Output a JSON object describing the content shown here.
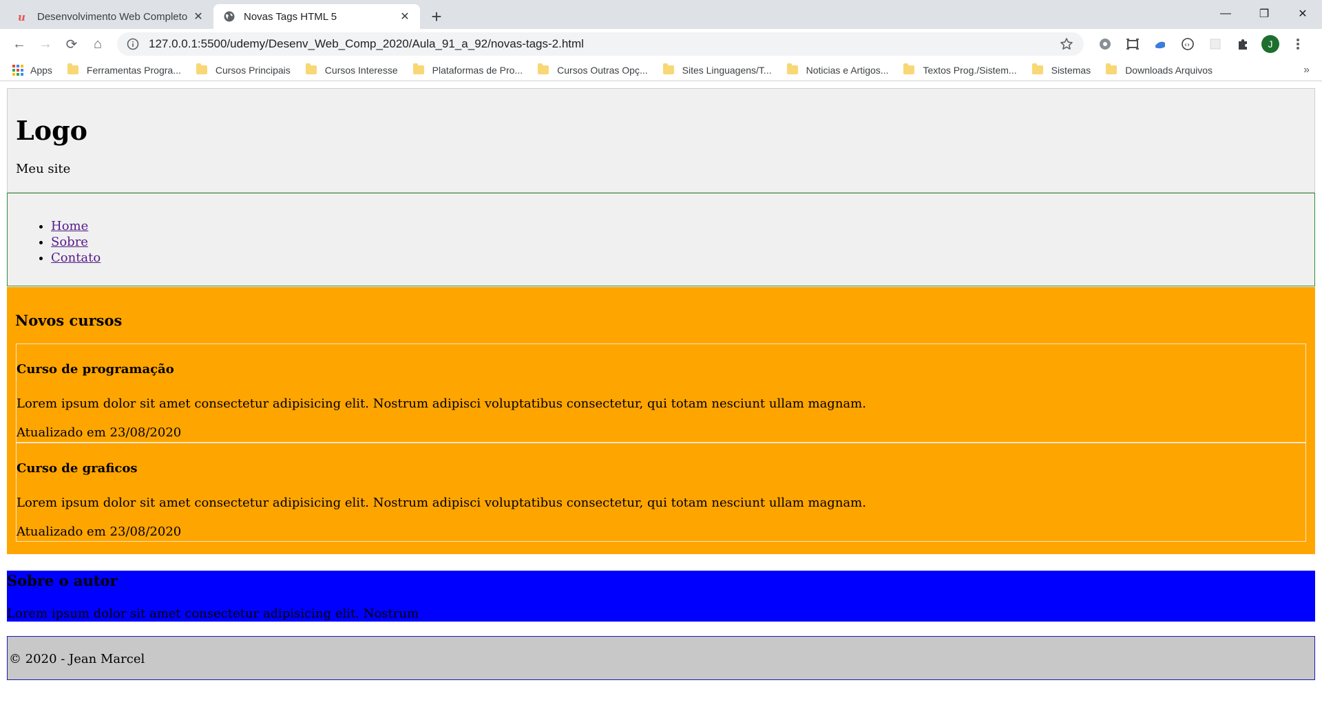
{
  "browser": {
    "tabs": [
      {
        "title": "Desenvolvimento Web Completo",
        "active": false,
        "favicon": "udemy-icon"
      },
      {
        "title": "Novas Tags HTML 5",
        "active": true,
        "favicon": "globe-icon"
      }
    ],
    "new_tab": "+",
    "window_controls": {
      "minimize": "—",
      "restore": "❐",
      "close": "✕"
    },
    "nav": {
      "back": "←",
      "forward": "→",
      "reload": "⟳",
      "home": "⌂"
    },
    "url": "127.0.0.1:5500/udemy/Desenv_Web_Comp_2020/Aula_91_a_92/novas-tags-2.html",
    "profile_initial": "J",
    "bookmarks": [
      {
        "label": "Apps",
        "type": "apps"
      },
      {
        "label": "Ferramentas Progra...",
        "type": "folder"
      },
      {
        "label": "Cursos Principais",
        "type": "folder"
      },
      {
        "label": "Cursos Interesse",
        "type": "folder"
      },
      {
        "label": "Plataformas de Pro...",
        "type": "folder"
      },
      {
        "label": "Cursos Outras Opç...",
        "type": "folder"
      },
      {
        "label": "Sites Linguagens/T...",
        "type": "folder"
      },
      {
        "label": "Noticias e Artigos...",
        "type": "folder"
      },
      {
        "label": "Textos Prog./Sistem...",
        "type": "folder"
      },
      {
        "label": "Sistemas",
        "type": "folder"
      },
      {
        "label": "Downloads Arquivos",
        "type": "folder"
      }
    ],
    "bookmarks_overflow": "»"
  },
  "page": {
    "header": {
      "logo": "Logo",
      "tagline": "Meu site"
    },
    "nav": {
      "items": [
        "Home",
        "Sobre",
        "Contato"
      ]
    },
    "courses": {
      "title": "Novos cursos",
      "items": [
        {
          "title": "Curso de programação",
          "description": "Lorem ipsum dolor sit amet consectetur adipisicing elit. Nostrum adipisci voluptatibus consectetur, qui totam nesciunt ullam magnam.",
          "updated": "Atualizado em 23/08/2020"
        },
        {
          "title": "Curso de graficos",
          "description": "Lorem ipsum dolor sit amet consectetur adipisicing elit. Nostrum adipisci voluptatibus consectetur, qui totam nesciunt ullam magnam.",
          "updated": "Atualizado em 23/08/2020"
        }
      ]
    },
    "author": {
      "title": "Sobre o autor",
      "text": "Lorem ipsum dolor sit amet consectetur adipisicing elit. Nostrum"
    },
    "footer": {
      "text": "© 2020 - Jean Marcel"
    }
  },
  "colors": {
    "header_bg": "#f0f0f0",
    "nav_border": "#2e8b3a",
    "courses_bg": "#ffa500",
    "author_bg": "#0000ff",
    "footer_bg": "#c8c8c8",
    "footer_border": "#1a1ab0",
    "link_visited": "#551a8b"
  }
}
